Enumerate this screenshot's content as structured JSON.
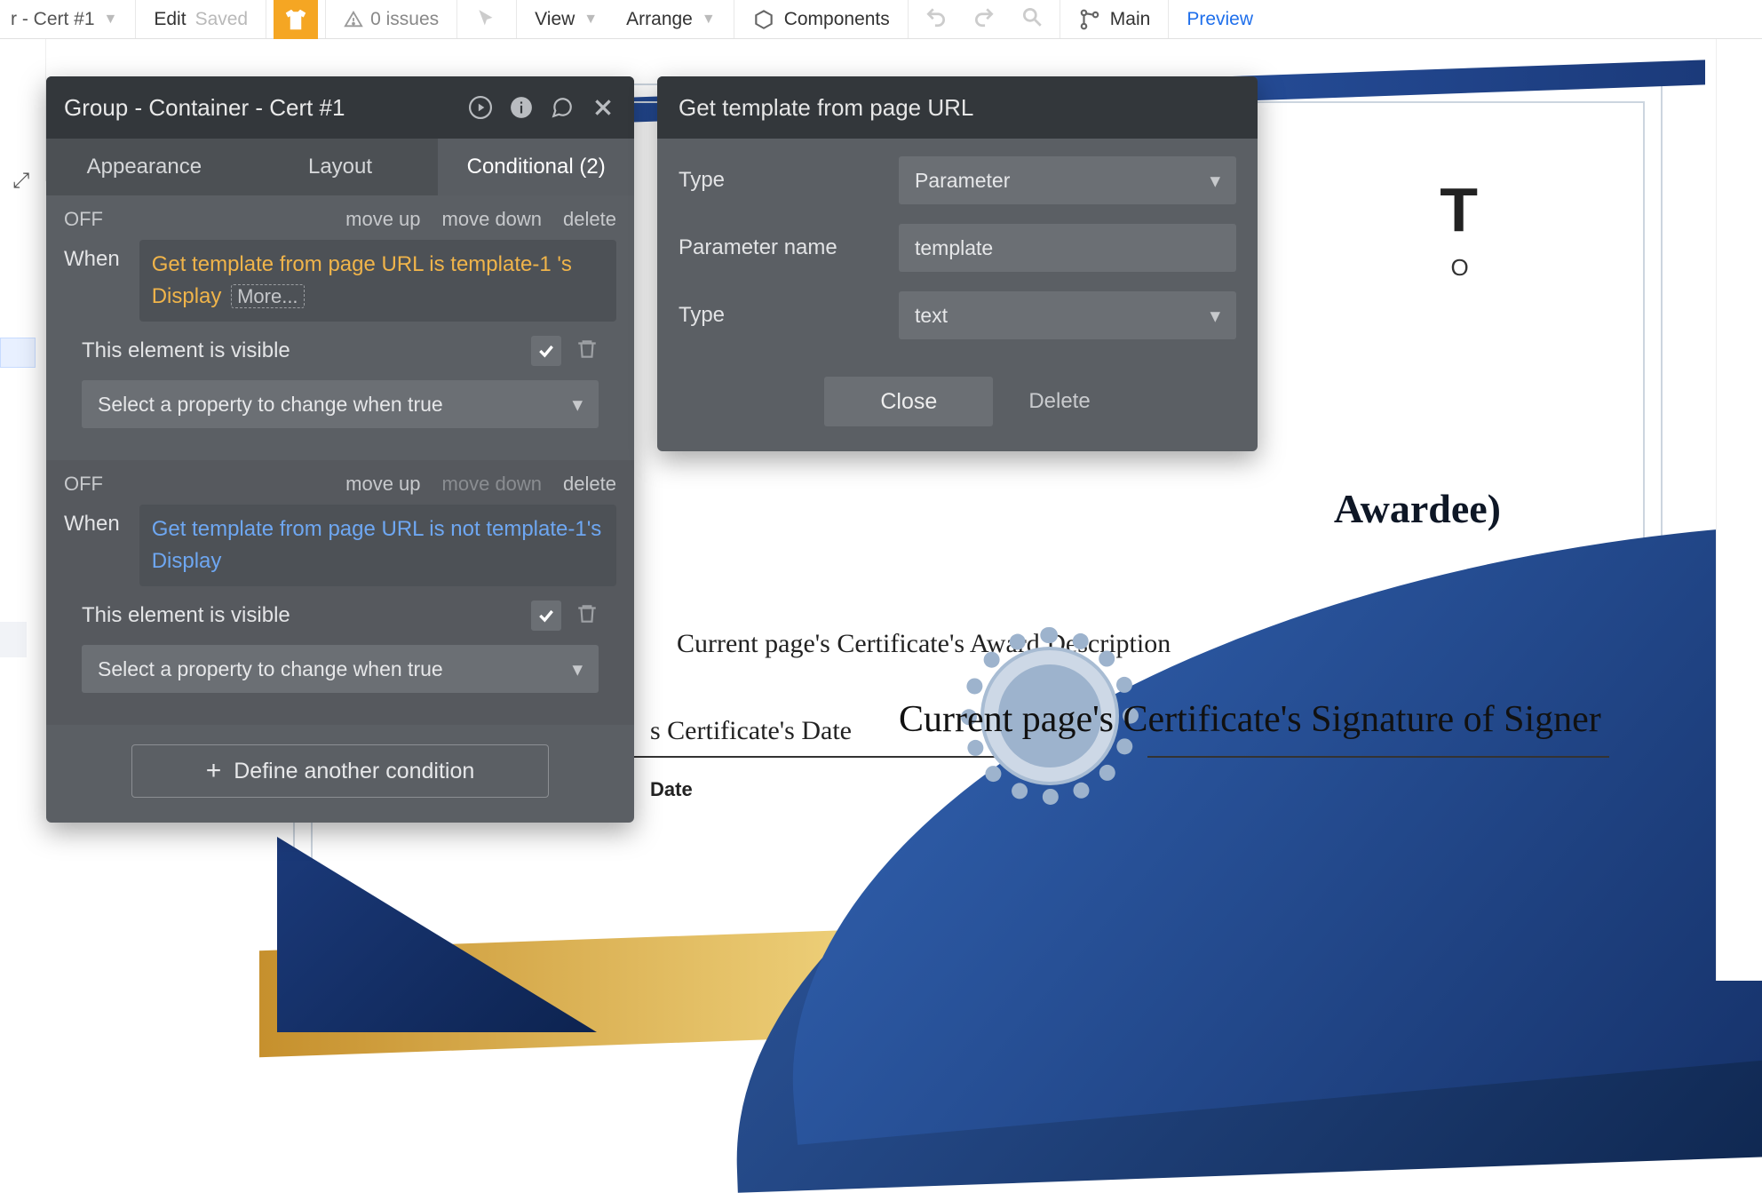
{
  "toolbar": {
    "element_name": "r - Cert #1",
    "edit": "Edit",
    "saved": "Saved",
    "issues": "0 issues",
    "view": "View",
    "arrange": "Arrange",
    "components": "Components",
    "main": "Main",
    "preview": "Preview"
  },
  "panel": {
    "title": "Group - Container - Cert #1",
    "tabs": {
      "appearance": "Appearance",
      "layout": "Layout",
      "conditional": "Conditional (2)"
    },
    "conditions": [
      {
        "state": "OFF",
        "move_up": "move up",
        "move_down": "move down",
        "delete": "delete",
        "when_label": "When",
        "expression": "Get template from page URL  is template-1 's Display",
        "more": "More...",
        "visible_label": "This element is visible",
        "checked": true,
        "select_placeholder": "Select a property to change when true"
      },
      {
        "state": "OFF",
        "move_up": "move up",
        "move_down": "move down",
        "delete": "delete",
        "when_label": "When",
        "expression": "Get template from page URL is not template-1's Display",
        "visible_label": "This element is visible",
        "checked": false,
        "select_placeholder": "Select a property to change when true"
      }
    ],
    "add_condition": "Define another condition"
  },
  "popup": {
    "title": "Get template from page URL",
    "rows": {
      "type1_label": "Type",
      "type1_value": "Parameter",
      "param_label": "Parameter name",
      "param_value": "template",
      "type2_label": "Type",
      "type2_value": "text"
    },
    "close": "Close",
    "delete": "Delete"
  },
  "certificate": {
    "head_line1_frag": "T",
    "head_line2_frag": "O",
    "awardee": "Awardee)",
    "desc": "Current page's Certificate's Award Description",
    "date_value": "s Certificate's Date",
    "date_label": "Date",
    "signature": "Current page's Certificate's Signature of Signer"
  }
}
